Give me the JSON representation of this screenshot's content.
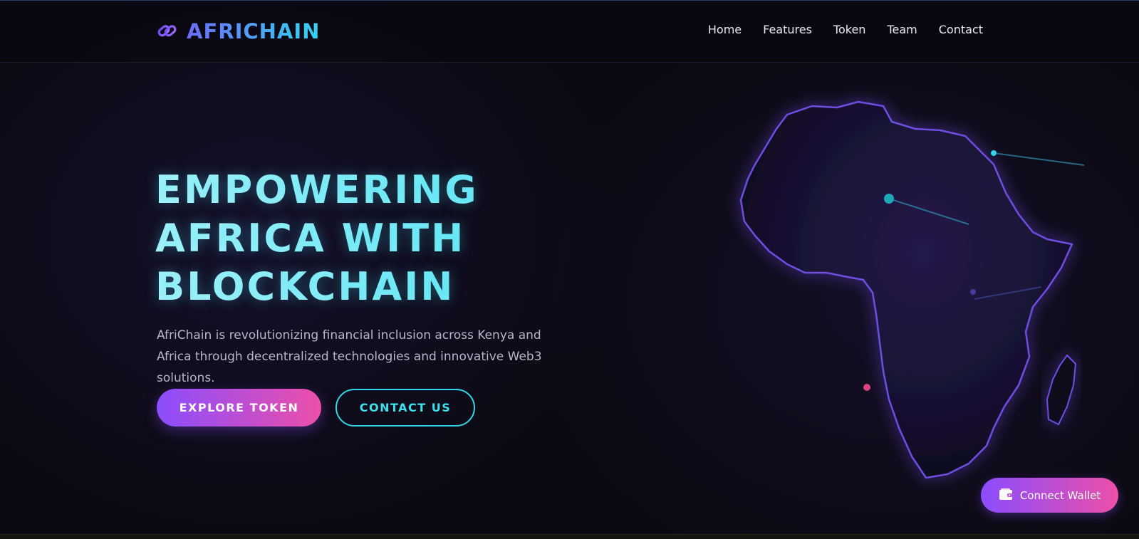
{
  "brand": {
    "name": "AFRICHAIN",
    "icon": "link-icon"
  },
  "nav": {
    "items": [
      "Home",
      "Features",
      "Token",
      "Team",
      "Contact"
    ]
  },
  "hero": {
    "title_lines": [
      "EMPOWERING",
      "AFRICA WITH",
      "BLOCKCHAIN"
    ],
    "description": "AfriChain is revolutionizing financial inclusion across Kenya and Africa through decentralized technologies and innovative Web3 solutions.",
    "primary_button": "EXPLORE TOKEN",
    "secondary_button": "CONTACT US"
  },
  "map": {
    "icon": "africa-map-icon"
  },
  "wallet": {
    "label": "Connect Wallet",
    "icon": "wallet-icon"
  },
  "colors": {
    "accent_cyan": "#3fe0ee",
    "accent_purple": "#8b4dff",
    "accent_pink": "#ec4fa8",
    "background": "#0b0a13"
  }
}
